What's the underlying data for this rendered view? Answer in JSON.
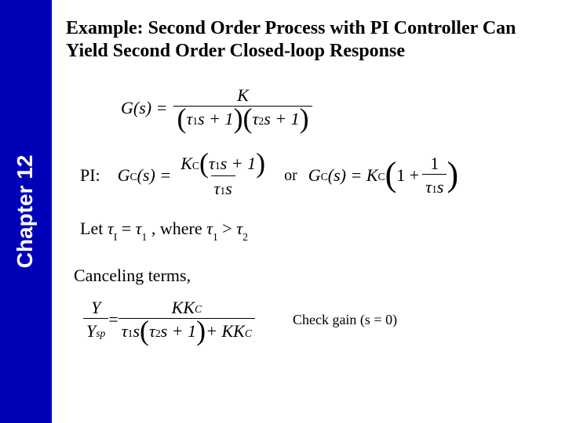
{
  "sidebar": {
    "chapter_label": "Chapter 12"
  },
  "title": "Example: Second Order Process with PI Controller Can Yield Second Order Closed-loop Response",
  "eq_g": {
    "lhs": "G(s) =",
    "num": "K",
    "den_tau1": "τ",
    "den_sub1": "1",
    "den_s1": "s + 1",
    "den_tau2": "τ",
    "den_sub2": "2",
    "den_s2": "s + 1"
  },
  "pi": {
    "label": "PI:",
    "lhs_g": "G",
    "lhs_csub": "C",
    "lhs_arg": "(s) =",
    "num_k": "K",
    "num_csub": "C",
    "num_tau": "τ",
    "num_sub1": "1",
    "num_s1": "s + 1",
    "den_tau": "τ",
    "den_sub1": "1",
    "den_s": "s",
    "or": "or",
    "rhs_g": "G",
    "rhs_csub": "C",
    "rhs_arg": "(s) = K",
    "rhs_kcsub": "C",
    "rhs_one": "1 +",
    "rhs_num": "1",
    "rhs_dtau": "τ",
    "rhs_dsub": "1",
    "rhs_ds": "s"
  },
  "let": {
    "prefix": "Let  ",
    "tau": "τ",
    "subI": "I",
    "eq": " = ",
    "subA": "1",
    "sep": ",  where ",
    "subB": "1",
    "gt": " > ",
    "subC": "2"
  },
  "cancel": "Canceling terms,",
  "ysp": {
    "num": "Y",
    "den_y": "Y",
    "den_sub": "sp",
    "eq": " = ",
    "rnum_k1": "KK",
    "rnum_csub": "C",
    "rden_tau": "τ",
    "rden_sub1": "1",
    "rden_s": "s",
    "rden_tau2": "τ",
    "rden_sub2": "2",
    "rden_s2": "s + 1",
    "rden_plus": " + KK",
    "rden_csub2": "C"
  },
  "check": "Check gain (s = 0)"
}
